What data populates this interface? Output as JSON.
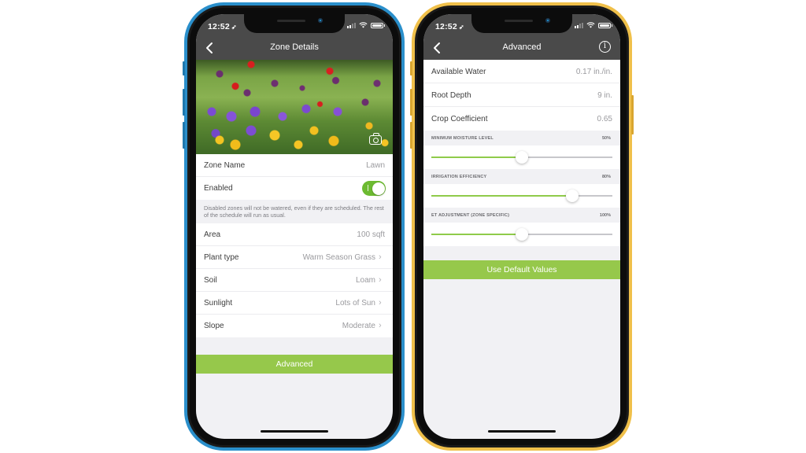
{
  "status_bar": {
    "time": "12:52",
    "location_icon": "location-arrow-icon",
    "signal_icon": "cellular-signal-icon",
    "wifi_icon": "wifi-icon",
    "battery_icon": "battery-icon"
  },
  "zone_details": {
    "nav": {
      "title": "Zone Details",
      "back_icon": "chevron-left-icon"
    },
    "photo": {
      "description": "Garden flowers photo",
      "camera_icon": "camera-icon"
    },
    "zone_name": {
      "label": "Zone Name",
      "value": "Lawn"
    },
    "enabled": {
      "label": "Enabled",
      "on": true
    },
    "footnote": "Disabled zones will not be watered, even if they are scheduled. The rest of the schedule will run as usual.",
    "properties": [
      {
        "label": "Area",
        "value": "100 sqft",
        "chevron": false
      },
      {
        "label": "Plant type",
        "value": "Warm Season Grass",
        "chevron": true
      },
      {
        "label": "Soil",
        "value": "Loam",
        "chevron": true
      },
      {
        "label": "Sunlight",
        "value": "Lots of Sun",
        "chevron": true
      },
      {
        "label": "Slope",
        "value": "Moderate",
        "chevron": true
      }
    ],
    "advanced_button": "Advanced"
  },
  "advanced": {
    "nav": {
      "title": "Advanced",
      "back_icon": "chevron-left-icon",
      "info_icon": "info-icon",
      "info_glyph": "i"
    },
    "rows": [
      {
        "label": "Available Water",
        "value": "0.17 in./in."
      },
      {
        "label": "Root Depth",
        "value": "9 in."
      },
      {
        "label": "Crop Coefficient",
        "value": "0.65"
      }
    ],
    "sliders": [
      {
        "label": "MINIMUM MOISTURE LEVEL",
        "value_text": "50%",
        "position": 0.5
      },
      {
        "label": "IRRIGATION EFFICIENCY",
        "value_text": "80%",
        "position": 0.78
      },
      {
        "label": "ET ADJUSTMENT (ZONE SPECIFIC)",
        "value_text": "100%",
        "position": 0.5
      }
    ],
    "default_button": "Use Default Values"
  },
  "colors": {
    "nav_bg": "#4a4a4a",
    "accent_green": "#96c84b",
    "toggle_green": "#6cba31",
    "slider_green": "#8fcb4a",
    "phone_left_frame": "#2a8fcb",
    "phone_right_frame": "#f0c04a",
    "screen_bg": "#f1f1f4"
  }
}
